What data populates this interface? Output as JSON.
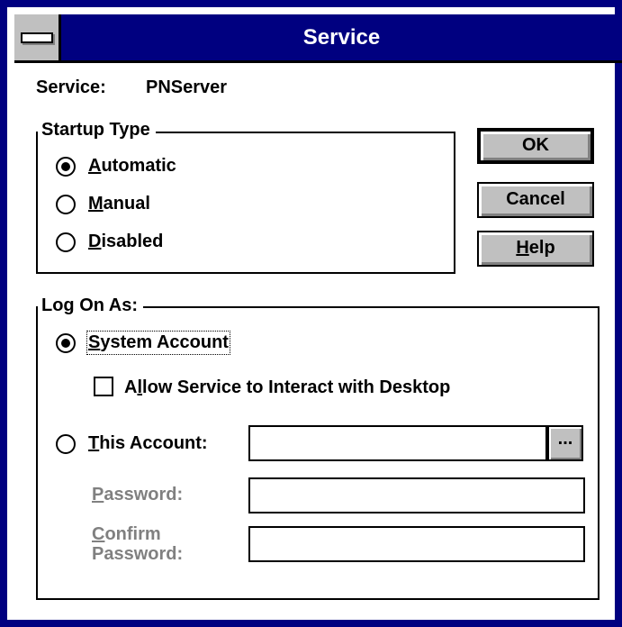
{
  "window": {
    "title": "Service"
  },
  "service": {
    "label": "Service:",
    "value": "PNServer"
  },
  "startup": {
    "legend": "Startup Type",
    "options": [
      {
        "accel": "A",
        "rest": "utomatic",
        "selected": true
      },
      {
        "accel": "M",
        "rest": "anual",
        "selected": false
      },
      {
        "accel": "D",
        "rest": "isabled",
        "selected": false
      }
    ]
  },
  "buttons": {
    "ok": "OK",
    "cancel": "Cancel",
    "help_accel": "H",
    "help_rest": "elp"
  },
  "logon": {
    "legend": "Log On As:",
    "system_accel": "S",
    "system_rest": "ystem Account",
    "system_selected": true,
    "interact_pre": "A",
    "interact_accel": "l",
    "interact_rest": "low Service to Interact with Desktop",
    "interact_checked": false,
    "this_accel": "T",
    "this_rest": "his Account:",
    "this_selected": false,
    "account_value": "",
    "browse_label": "...",
    "password_accel": "P",
    "password_rest": "assword:",
    "password_value": "",
    "confirm_accel": "C",
    "confirm_rest": "onfirm",
    "confirm_line2": "Password:",
    "confirm_value": ""
  }
}
